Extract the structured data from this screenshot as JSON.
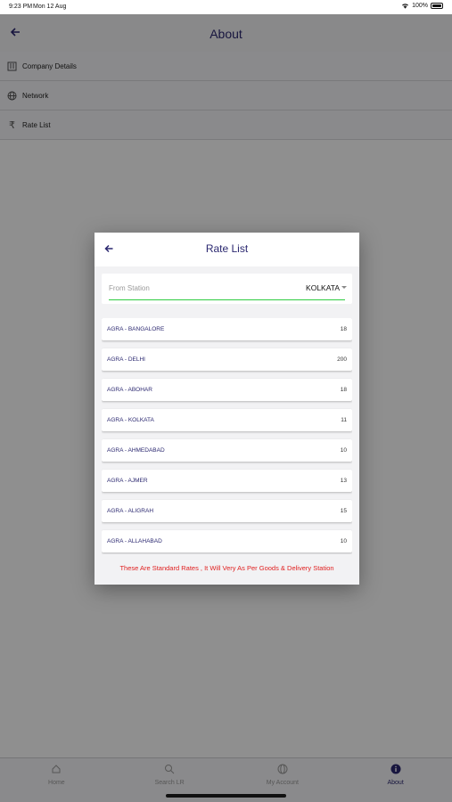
{
  "status_bar": {
    "time": "9:23 PM",
    "date": "Mon 12 Aug",
    "battery": "100%"
  },
  "header": {
    "title": "About"
  },
  "menu": [
    {
      "label": "Company Details",
      "icon": "company-icon"
    },
    {
      "label": "Network",
      "icon": "globe-icon"
    },
    {
      "label": "Rate List",
      "icon": "rupee-icon"
    }
  ],
  "dialog": {
    "title": "Rate List",
    "from_station_label": "From Station",
    "from_station_value": "KOLKATA",
    "rates": [
      {
        "route": "AGRA - BANGALORE",
        "rate": "18"
      },
      {
        "route": "AGRA - DELHI",
        "rate": "200"
      },
      {
        "route": "AGRA - ABOHAR",
        "rate": "18"
      },
      {
        "route": "AGRA - KOLKATA",
        "rate": "11"
      },
      {
        "route": "AGRA - AHMEDABAD",
        "rate": "10"
      },
      {
        "route": "AGRA - AJMER",
        "rate": "13"
      },
      {
        "route": "AGRA - ALIGRAH",
        "rate": "15"
      },
      {
        "route": "AGRA - ALLAHABAD",
        "rate": "10"
      }
    ],
    "note": "These Are Standard Rates , It Will Very As Per Goods & Delivery Station"
  },
  "tabs": [
    {
      "label": "Home",
      "icon": "home-icon"
    },
    {
      "label": "Search LR",
      "icon": "search-icon"
    },
    {
      "label": "My Account",
      "icon": "globe-icon"
    },
    {
      "label": "About",
      "icon": "info-icon",
      "active": true
    }
  ],
  "colors": {
    "accent": "#2b2870",
    "underline": "#2ecc40",
    "note": "#e02020"
  }
}
